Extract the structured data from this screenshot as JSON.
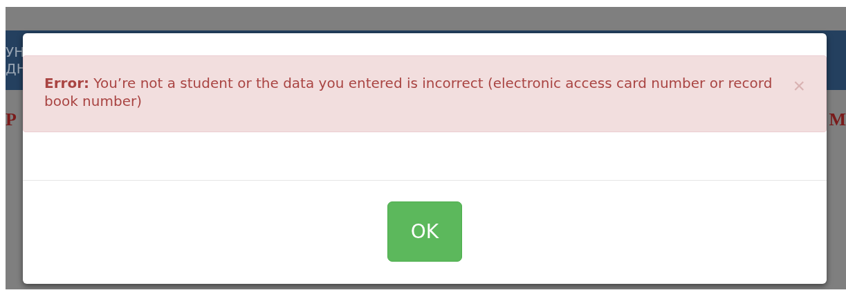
{
  "background_page": {
    "header_lines": [
      "УН",
      "ДН"
    ],
    "left_heading": "Р",
    "right_heading": "М"
  },
  "dialog": {
    "alert": {
      "label": "Error:",
      "message": "You’re not a student or the data you entered is incorrect (electronic access card number or record book number)",
      "close": "×"
    },
    "buttons": [
      "OK"
    ]
  }
}
